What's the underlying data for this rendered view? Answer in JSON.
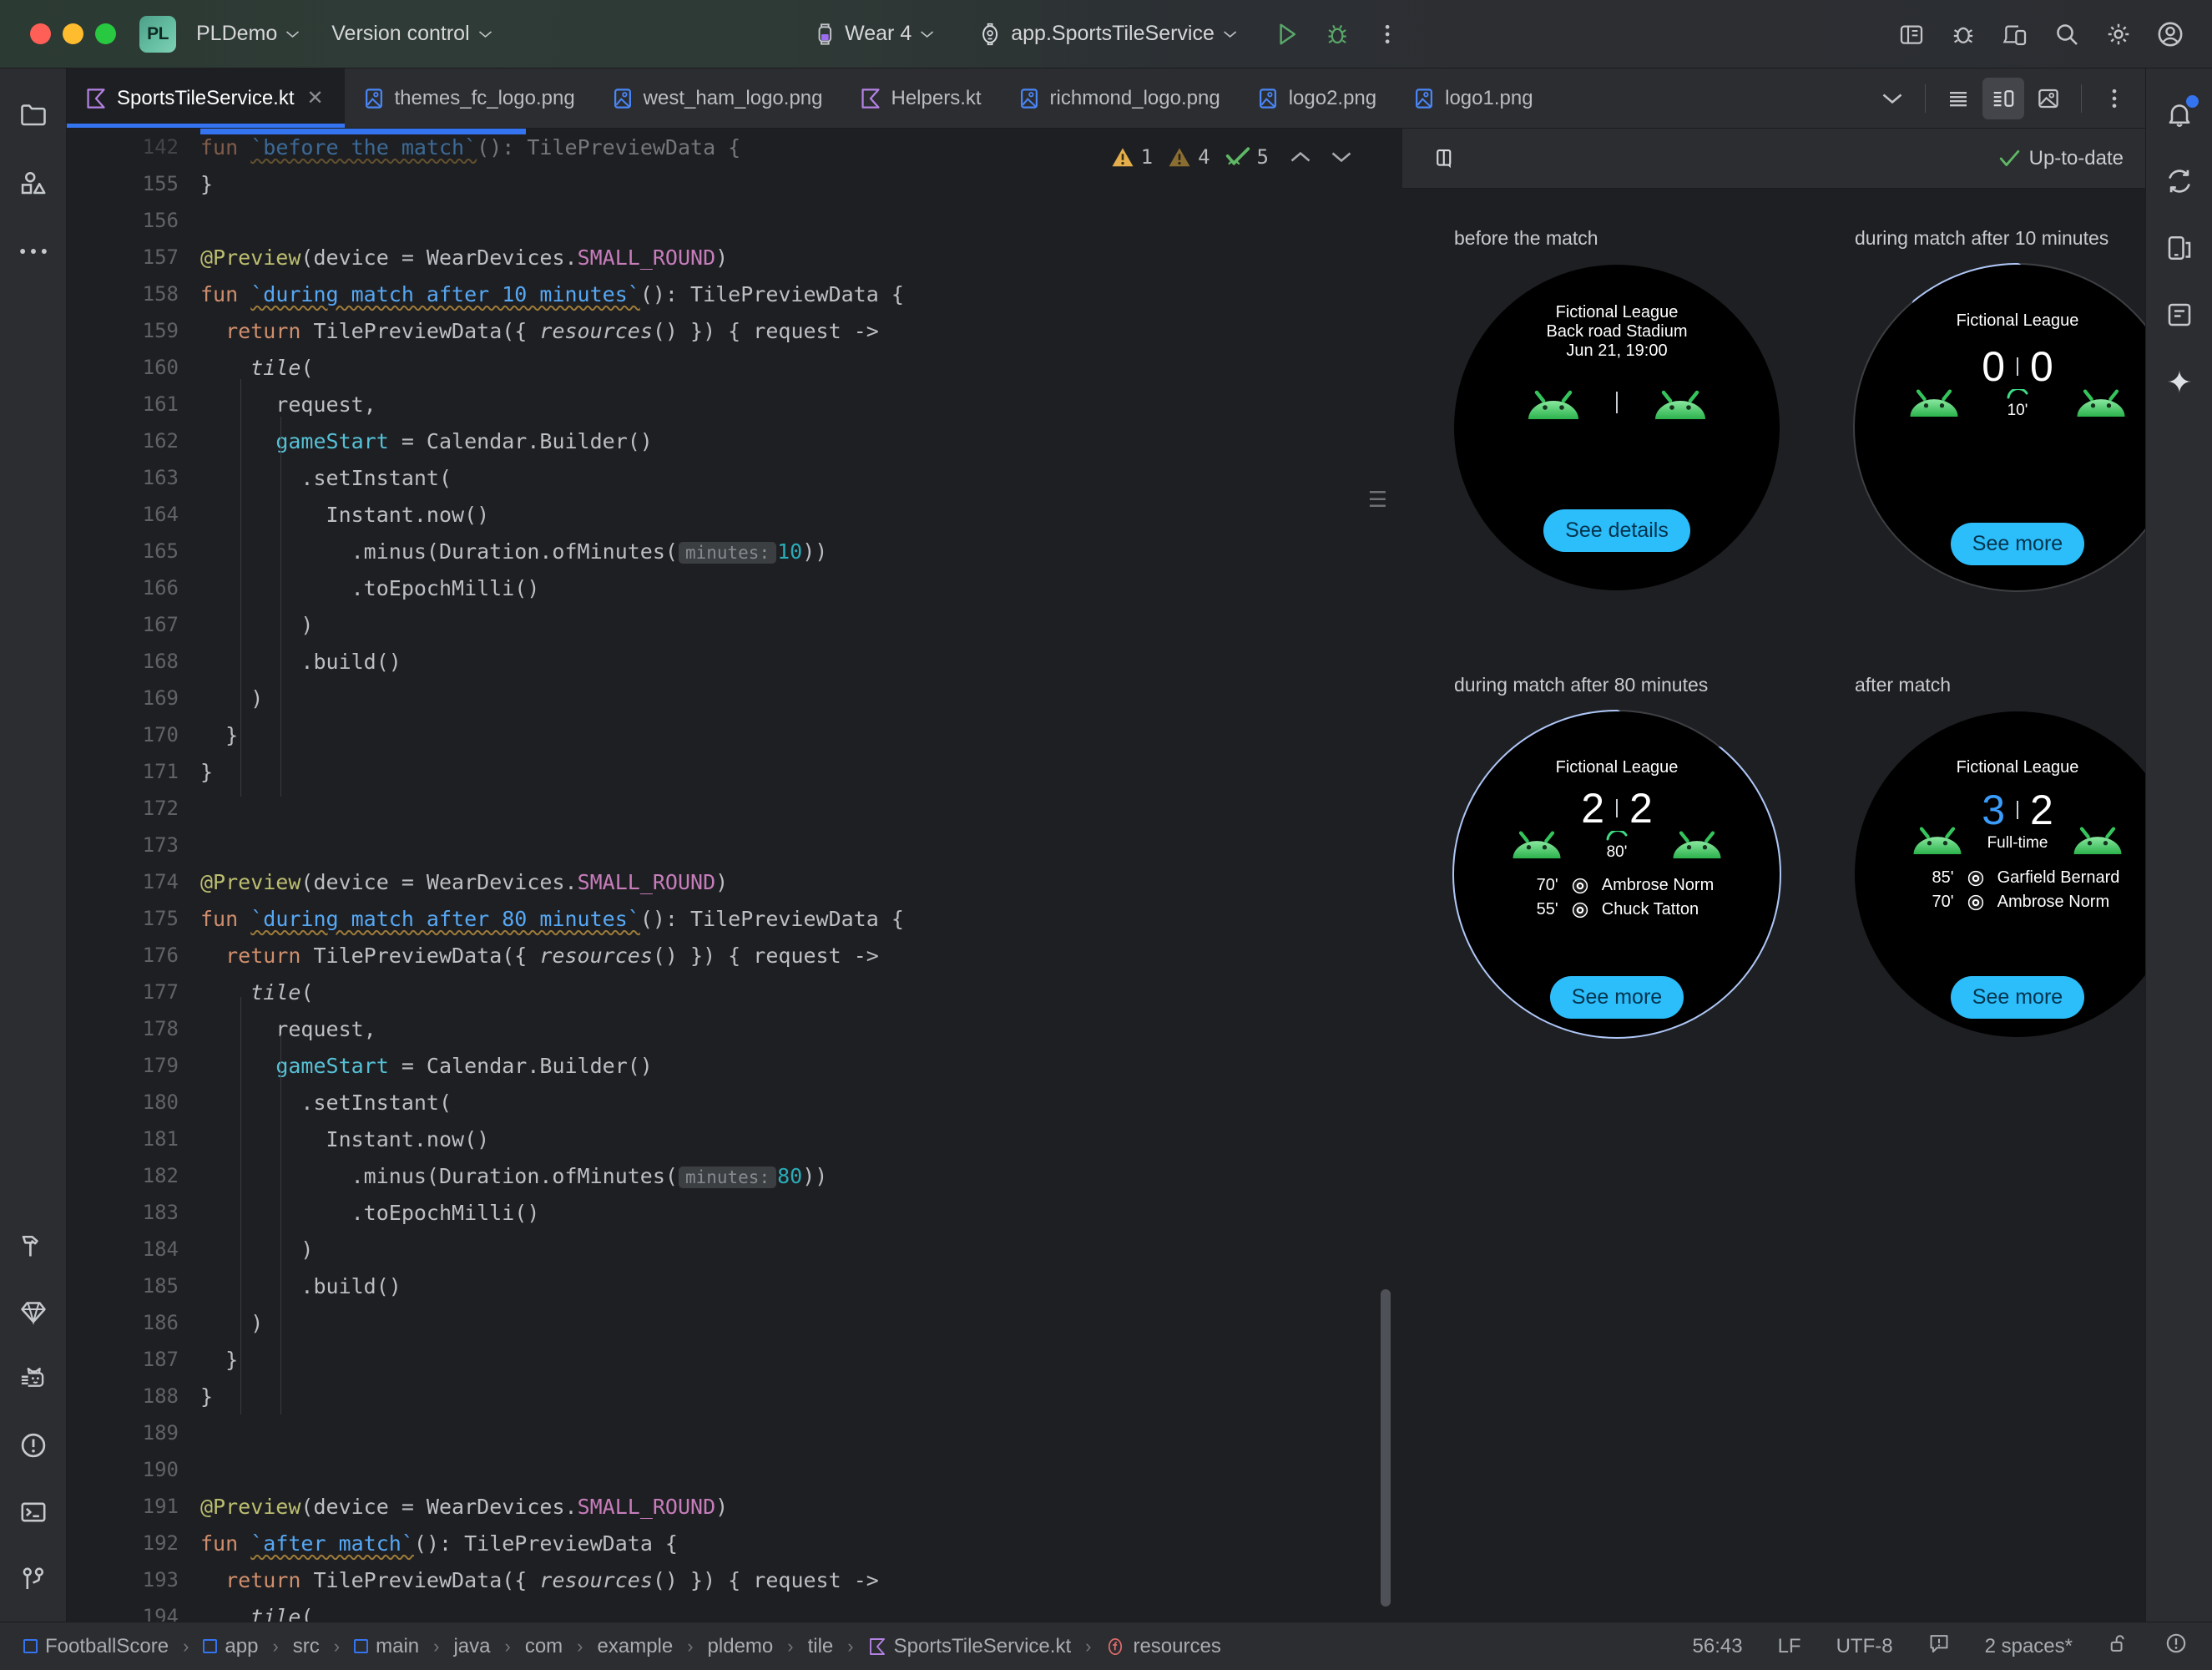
{
  "titlebar": {
    "project_badge": "PL",
    "project_name": "PLDemo",
    "version_control": "Version control",
    "device": "Wear 4",
    "run_config": "app.SportsTileService",
    "run_icon": "run-play-icon",
    "debug_icon": "debug-bug-icon",
    "more_icon": "more-vertical-icon"
  },
  "tabs": [
    {
      "label": "SportsTileService.kt",
      "icon": "kotlin-file-icon",
      "active": true,
      "closable": true
    },
    {
      "label": "themes_fc_logo.png",
      "icon": "image-file-icon",
      "active": false,
      "closable": false
    },
    {
      "label": "west_ham_logo.png",
      "icon": "image-file-icon",
      "active": false,
      "closable": false
    },
    {
      "label": "Helpers.kt",
      "icon": "kotlin-file-icon",
      "active": false,
      "closable": false
    },
    {
      "label": "richmond_logo.png",
      "icon": "image-file-icon",
      "active": false,
      "closable": false
    },
    {
      "label": "logo2.png",
      "icon": "image-file-icon",
      "active": false,
      "closable": false
    },
    {
      "label": "logo1.png",
      "icon": "image-file-icon",
      "active": false,
      "closable": false
    }
  ],
  "tabstrip_actions": {
    "overflow_icon": "chevron-down-icon",
    "list_view_icon": "list-view-icon",
    "split_view_icon": "split-editor-icon",
    "design_view_icon": "design-view-icon",
    "more_icon": "more-vertical-icon"
  },
  "left_rail": [
    {
      "name": "project-tool-window",
      "icon": "folder-icon"
    },
    {
      "name": "resource-manager-tool-window",
      "icon": "shapes-icon"
    },
    {
      "name": "more-tool-windows",
      "icon": "ellipsis-icon"
    }
  ],
  "left_rail_bottom": [
    {
      "name": "build-tool-window",
      "icon": "hammer-icon"
    },
    {
      "name": "gradle-tool-window",
      "icon": "diamond-icon"
    },
    {
      "name": "logcat-tool-window",
      "icon": "cat-icon"
    },
    {
      "name": "problems-tool-window",
      "icon": "warning-circle-icon"
    },
    {
      "name": "terminal-tool-window",
      "icon": "terminal-icon"
    },
    {
      "name": "version-control-tool-window",
      "icon": "branch-icon"
    }
  ],
  "right_rail": [
    {
      "name": "notifications-tool-window",
      "icon": "bell-icon",
      "badge": true
    },
    {
      "name": "gradle-sync-tool-window",
      "icon": "refresh-arrows-icon",
      "badge": false
    },
    {
      "name": "device-manager-tool-window",
      "icon": "device-icon",
      "badge": false
    },
    {
      "name": "device-file-explorer-tool-window",
      "icon": "device-file-icon",
      "badge": false
    },
    {
      "name": "gemini-tool-window",
      "icon": "sparkle-icon",
      "badge": false
    }
  ],
  "editor": {
    "inspections": {
      "warning_count": "1",
      "weak_warning_count": "4",
      "ok_count": "5"
    },
    "lines": [
      {
        "no": "142",
        "partial": true,
        "tokens": [
          {
            "t": "fun ",
            "c": "kw"
          },
          {
            "t": "`before the match`",
            "c": "fnm wavy"
          },
          {
            "t": "(): TilePreviewData {",
            "c": "pln"
          }
        ]
      },
      {
        "no": "155",
        "tokens": [
          {
            "t": "}",
            "c": "pln"
          }
        ]
      },
      {
        "no": "156",
        "tokens": []
      },
      {
        "no": "157",
        "tokens": [
          {
            "t": "@Preview",
            "c": "ann"
          },
          {
            "t": "(device = WearDevices.",
            "c": "pln"
          },
          {
            "t": "SMALL_ROUND",
            "c": "cnst"
          },
          {
            "t": ")",
            "c": "pln"
          }
        ]
      },
      {
        "no": "158",
        "tokens": [
          {
            "t": "fun ",
            "c": "kw"
          },
          {
            "t": "`during match after 10 minutes`",
            "c": "fnm wavy"
          },
          {
            "t": "(): TilePreviewData {",
            "c": "pln"
          }
        ]
      },
      {
        "no": "159",
        "tokens": [
          {
            "t": "  ",
            "c": "pln"
          },
          {
            "t": "return",
            "c": "kw"
          },
          {
            "t": " TilePreviewData({ ",
            "c": "pln"
          },
          {
            "t": "resources",
            "c": "ital"
          },
          {
            "t": "() }) { request ->",
            "c": "pln"
          }
        ]
      },
      {
        "no": "160",
        "tokens": [
          {
            "t": "    ",
            "c": "pln"
          },
          {
            "t": "tile",
            "c": "ital"
          },
          {
            "t": "(",
            "c": "pln"
          }
        ]
      },
      {
        "no": "161",
        "tokens": [
          {
            "t": "      request,",
            "c": "pln"
          }
        ]
      },
      {
        "no": "162",
        "tokens": [
          {
            "t": "      ",
            "c": "pln"
          },
          {
            "t": "gameStart",
            "c": "prop"
          },
          {
            "t": " = Calendar.Builder()",
            "c": "pln"
          }
        ]
      },
      {
        "no": "163",
        "tokens": [
          {
            "t": "        .setInstant(",
            "c": "pln"
          }
        ]
      },
      {
        "no": "164",
        "tokens": [
          {
            "t": "          Instant.now()",
            "c": "pln"
          }
        ]
      },
      {
        "no": "165",
        "tokens": [
          {
            "t": "            .minus(Duration.ofMinutes(",
            "c": "pln"
          },
          {
            "t": "minutes:",
            "c": "hintchip"
          },
          {
            "t": "10",
            "c": "num"
          },
          {
            "t": "))",
            "c": "pln"
          }
        ]
      },
      {
        "no": "166",
        "tokens": [
          {
            "t": "            .toEpochMilli()",
            "c": "pln"
          }
        ]
      },
      {
        "no": "167",
        "tokens": [
          {
            "t": "        )",
            "c": "pln"
          }
        ]
      },
      {
        "no": "168",
        "tokens": [
          {
            "t": "        .build()",
            "c": "pln"
          }
        ]
      },
      {
        "no": "169",
        "tokens": [
          {
            "t": "    )",
            "c": "pln"
          }
        ]
      },
      {
        "no": "170",
        "tokens": [
          {
            "t": "  }",
            "c": "pln"
          }
        ]
      },
      {
        "no": "171",
        "tokens": [
          {
            "t": "}",
            "c": "pln"
          }
        ]
      },
      {
        "no": "172",
        "tokens": []
      },
      {
        "no": "173",
        "tokens": []
      },
      {
        "no": "174",
        "tokens": [
          {
            "t": "@Preview",
            "c": "ann"
          },
          {
            "t": "(device = WearDevices.",
            "c": "pln"
          },
          {
            "t": "SMALL_ROUND",
            "c": "cnst"
          },
          {
            "t": ")",
            "c": "pln"
          }
        ]
      },
      {
        "no": "175",
        "tokens": [
          {
            "t": "fun ",
            "c": "kw"
          },
          {
            "t": "`during match after 80 minutes`",
            "c": "fnm wavy"
          },
          {
            "t": "(): TilePreviewData {",
            "c": "pln"
          }
        ]
      },
      {
        "no": "176",
        "tokens": [
          {
            "t": "  ",
            "c": "pln"
          },
          {
            "t": "return",
            "c": "kw"
          },
          {
            "t": " TilePreviewData({ ",
            "c": "pln"
          },
          {
            "t": "resources",
            "c": "ital"
          },
          {
            "t": "() }) { request ->",
            "c": "pln"
          }
        ]
      },
      {
        "no": "177",
        "tokens": [
          {
            "t": "    ",
            "c": "pln"
          },
          {
            "t": "tile",
            "c": "ital"
          },
          {
            "t": "(",
            "c": "pln"
          }
        ]
      },
      {
        "no": "178",
        "tokens": [
          {
            "t": "      request,",
            "c": "pln"
          }
        ]
      },
      {
        "no": "179",
        "tokens": [
          {
            "t": "      ",
            "c": "pln"
          },
          {
            "t": "gameStart",
            "c": "prop"
          },
          {
            "t": " = Calendar.Builder()",
            "c": "pln"
          }
        ]
      },
      {
        "no": "180",
        "tokens": [
          {
            "t": "        .setInstant(",
            "c": "pln"
          }
        ]
      },
      {
        "no": "181",
        "tokens": [
          {
            "t": "          Instant.now()",
            "c": "pln"
          }
        ]
      },
      {
        "no": "182",
        "tokens": [
          {
            "t": "            .minus(Duration.ofMinutes(",
            "c": "pln"
          },
          {
            "t": "minutes:",
            "c": "hintchip"
          },
          {
            "t": "80",
            "c": "num"
          },
          {
            "t": "))",
            "c": "pln"
          }
        ]
      },
      {
        "no": "183",
        "tokens": [
          {
            "t": "            .toEpochMilli()",
            "c": "pln"
          }
        ]
      },
      {
        "no": "184",
        "tokens": [
          {
            "t": "        )",
            "c": "pln"
          }
        ]
      },
      {
        "no": "185",
        "tokens": [
          {
            "t": "        .build()",
            "c": "pln"
          }
        ]
      },
      {
        "no": "186",
        "tokens": [
          {
            "t": "    )",
            "c": "pln"
          }
        ]
      },
      {
        "no": "187",
        "tokens": [
          {
            "t": "  }",
            "c": "pln"
          }
        ]
      },
      {
        "no": "188",
        "tokens": [
          {
            "t": "}",
            "c": "pln"
          }
        ]
      },
      {
        "no": "189",
        "tokens": []
      },
      {
        "no": "190",
        "tokens": []
      },
      {
        "no": "191",
        "tokens": [
          {
            "t": "@Preview",
            "c": "ann"
          },
          {
            "t": "(device = WearDevices.",
            "c": "pln"
          },
          {
            "t": "SMALL_ROUND",
            "c": "cnst"
          },
          {
            "t": ")",
            "c": "pln"
          }
        ]
      },
      {
        "no": "192",
        "tokens": [
          {
            "t": "fun ",
            "c": "kw"
          },
          {
            "t": "`after match`",
            "c": "fnm wavy"
          },
          {
            "t": "(): TilePreviewData {",
            "c": "pln"
          }
        ]
      },
      {
        "no": "193",
        "tokens": [
          {
            "t": "  ",
            "c": "pln"
          },
          {
            "t": "return",
            "c": "kw"
          },
          {
            "t": " TilePreviewData({ ",
            "c": "pln"
          },
          {
            "t": "resources",
            "c": "ital"
          },
          {
            "t": "() }) { request ->",
            "c": "pln"
          }
        ]
      },
      {
        "no": "194",
        "tokens": [
          {
            "t": "    ",
            "c": "pln"
          },
          {
            "t": "tile",
            "c": "ital"
          },
          {
            "t": "(",
            "c": "pln"
          }
        ]
      }
    ]
  },
  "preview": {
    "toolbar_icon": "layout-columns-icon",
    "status": "Up-to-date",
    "status_icon": "check-icon",
    "tiles": [
      {
        "label": "before the match",
        "league": "Fictional League",
        "stadium": "Back road Stadium",
        "date": "Jun 21, 19:00",
        "cta": "See details",
        "state": "pre",
        "progress_pct": 0
      },
      {
        "label": "during match after 10 minutes",
        "league": "Fictional League",
        "home_score": "0",
        "away_score": "0",
        "minute": "10'",
        "cta": "See more",
        "state": "live",
        "progress_pct": 11,
        "scorers": []
      },
      {
        "label": "during match after 80 minutes",
        "league": "Fictional League",
        "home_score": "2",
        "away_score": "2",
        "minute": "80'",
        "cta": "See more",
        "state": "live",
        "progress_pct": 89,
        "scorers": [
          {
            "minute": "70'",
            "name": "Ambrose Norm"
          },
          {
            "minute": "55'",
            "name": "Chuck Tatton"
          }
        ]
      },
      {
        "label": "after match",
        "league": "Fictional League",
        "home_score": "3",
        "away_score": "2",
        "minute": "Full-time",
        "cta": "See more",
        "state": "final",
        "winner": "home",
        "progress_pct": 0,
        "scorers": [
          {
            "minute": "85'",
            "name": "Garfield Bernard"
          },
          {
            "minute": "70'",
            "name": "Ambrose Norm"
          }
        ]
      }
    ]
  },
  "statusbar": {
    "breadcrumb": [
      {
        "label": "FootballScore",
        "icon": "module-icon"
      },
      {
        "label": "app",
        "icon": "module-icon"
      },
      {
        "label": "src",
        "icon": ""
      },
      {
        "label": "main",
        "icon": "module-icon"
      },
      {
        "label": "java",
        "icon": ""
      },
      {
        "label": "com",
        "icon": ""
      },
      {
        "label": "example",
        "icon": ""
      },
      {
        "label": "pldemo",
        "icon": ""
      },
      {
        "label": "tile",
        "icon": ""
      },
      {
        "label": "SportsTileService.kt",
        "icon": "kotlin-file-icon"
      },
      {
        "label": "resources",
        "icon": "function-icon"
      }
    ],
    "caret": "56:43",
    "line_separator": "LF",
    "encoding": "UTF-8",
    "read_only_icon": "inspection-icon",
    "indent": "2 spaces*",
    "lock_icon": "lock-open-icon",
    "notify_icon": "exclamation-circle-icon"
  },
  "colors": {
    "accent_blue": "#3574f0",
    "cta_blue": "#2cbdfb",
    "progress_blue": "#aec6f6",
    "win_blue": "#3b9dfb",
    "green_live": "#3ddc84",
    "bg": "#1e1f22",
    "panel": "#2b2d30"
  }
}
